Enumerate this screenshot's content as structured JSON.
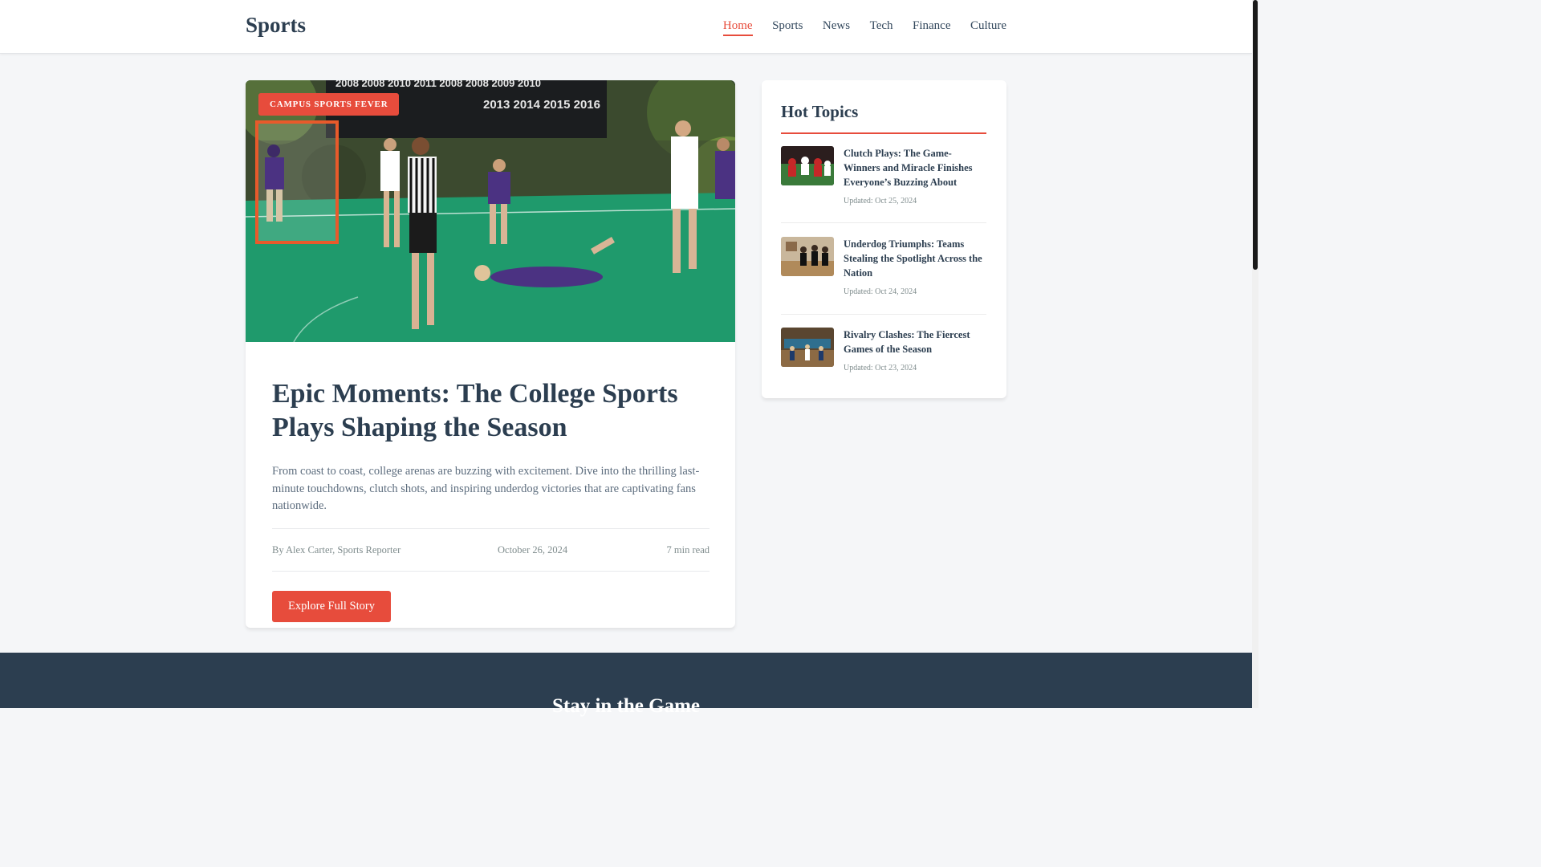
{
  "header": {
    "logo": "Sports",
    "nav": [
      {
        "label": "Home",
        "active": true
      },
      {
        "label": "Sports",
        "active": false
      },
      {
        "label": "News",
        "active": false
      },
      {
        "label": "Tech",
        "active": false
      },
      {
        "label": "Finance",
        "active": false
      },
      {
        "label": "Culture",
        "active": false
      }
    ]
  },
  "article": {
    "category": "CAMPUS SPORTS FEVER",
    "headline": "Epic Moments: The College Sports Plays Shaping the Season",
    "summary": "From coast to coast, college arenas are buzzing with excitement. Dive into the thrilling last-minute touchdowns, clutch shots, and inspiring underdog victories that are captivating fans nationwide.",
    "author": "By Alex Carter, Sports Reporter",
    "date": "October 26, 2024",
    "read_time": "7 min read",
    "cta_label": "Explore Full Story",
    "hero_banner_years_top": "2008 2008 2010 2011   2008 2008 2009 2010",
    "hero_banner_years_bottom": "2013 2014 2015 2016"
  },
  "sidebar": {
    "title": "Hot Topics",
    "topics": [
      {
        "title": "Clutch Plays: The Game-Winners and Miracle Finishes Everyone’s Buzzing About",
        "date": "Updated: Oct 25, 2024"
      },
      {
        "title": "Underdog Triumphs: Teams Stealing the Spotlight Across the Nation",
        "date": "Updated: Oct 24, 2024"
      },
      {
        "title": "Rivalry Clashes: The Fiercest Games of the Season",
        "date": "Updated: Oct 23, 2024"
      }
    ]
  },
  "newsletter": {
    "title": "Stay in the Game"
  },
  "colors": {
    "accent": "#e74c3c",
    "primary_text": "#2c3e50",
    "footer_bg": "#2c3e50"
  }
}
